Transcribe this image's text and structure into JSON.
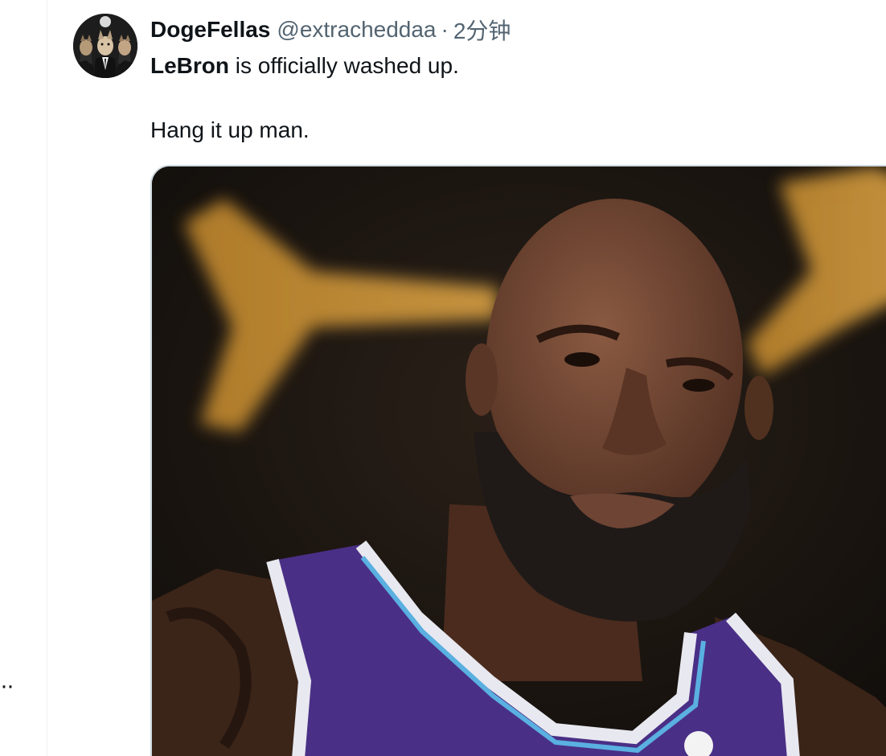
{
  "tweet": {
    "display_name": "DogeFellas",
    "handle": "@extracheddaa",
    "separator": "·",
    "timestamp": "2分钟",
    "text_bold": "LeBron",
    "text_rest": " is officially washed up.",
    "text_line2": "Hang it up man.",
    "avatar_icon": "avatar-three-dogs-in-suits",
    "media_icon": "photo-basketball-player-purple-jersey"
  },
  "sidebar": {
    "more_label": "··"
  },
  "colors": {
    "text_primary": "#0f1419",
    "text_secondary": "#536471",
    "border": "#cfd9de",
    "jersey_purple": "#4a2f86"
  }
}
